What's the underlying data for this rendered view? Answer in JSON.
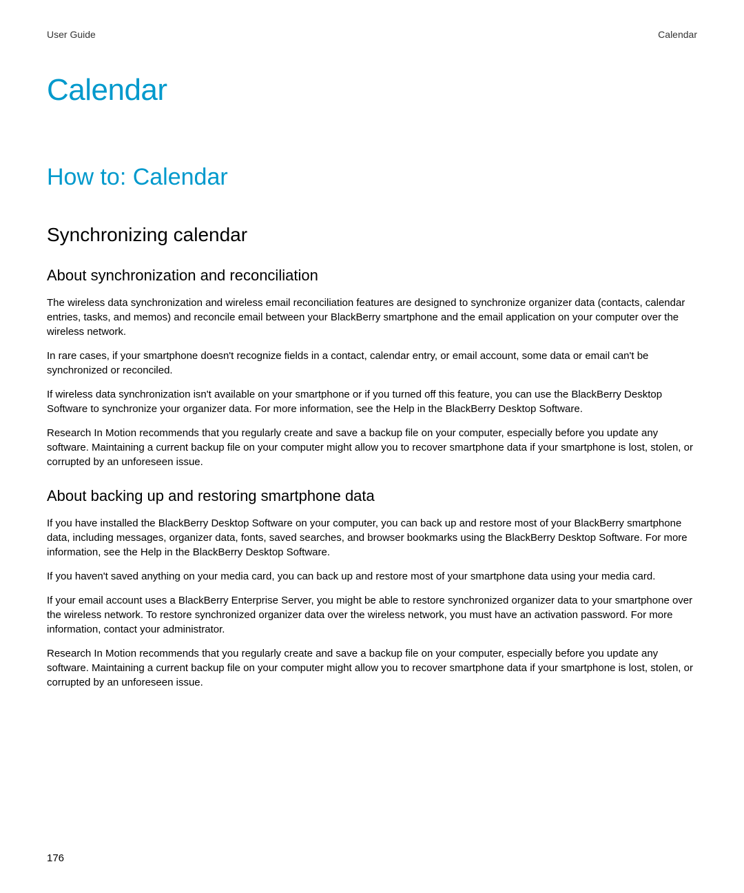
{
  "header": {
    "left": "User Guide",
    "right": "Calendar"
  },
  "chapter_title": "Calendar",
  "section_title": "How to: Calendar",
  "subsection_title": "Synchronizing calendar",
  "topics": [
    {
      "title": "About synchronization and reconciliation",
      "paragraphs": [
        "The wireless data synchronization and wireless email reconciliation features are designed to synchronize organizer data (contacts, calendar entries, tasks, and memos) and reconcile email between your BlackBerry smartphone and the email application on your computer over the wireless network.",
        "In rare cases, if your smartphone doesn't recognize fields in a contact, calendar entry, or email account, some data or email can't be synchronized or reconciled.",
        "If wireless data synchronization isn't available on your smartphone or if you turned off this feature, you can use the BlackBerry Desktop Software to synchronize your organizer data. For more information, see the Help in the BlackBerry Desktop Software.",
        "Research In Motion recommends that you regularly create and save a backup file on your computer, especially before you update any software. Maintaining a current backup file on your computer might allow you to recover smartphone data if your smartphone is lost, stolen, or corrupted by an unforeseen issue."
      ]
    },
    {
      "title": "About backing up and restoring smartphone data",
      "paragraphs": [
        "If you have installed the BlackBerry Desktop Software on your computer, you can back up and restore most of your BlackBerry smartphone data, including messages, organizer data, fonts, saved searches, and browser bookmarks using the BlackBerry Desktop Software. For more information, see the Help in the BlackBerry Desktop Software.",
        "If you haven't saved anything on your media card, you can back up and restore most of your smartphone data using your media card.",
        "If your email account uses a BlackBerry Enterprise Server, you might be able to restore synchronized organizer data to your smartphone over the wireless network. To restore synchronized organizer data over the wireless network, you must have an activation password. For more information, contact your administrator.",
        "Research In Motion recommends that you regularly create and save a backup file on your computer, especially before you update any software. Maintaining a current backup file on your computer might allow you to recover smartphone data if your smartphone is lost, stolen, or corrupted by an unforeseen issue."
      ]
    }
  ],
  "page_number": "176"
}
